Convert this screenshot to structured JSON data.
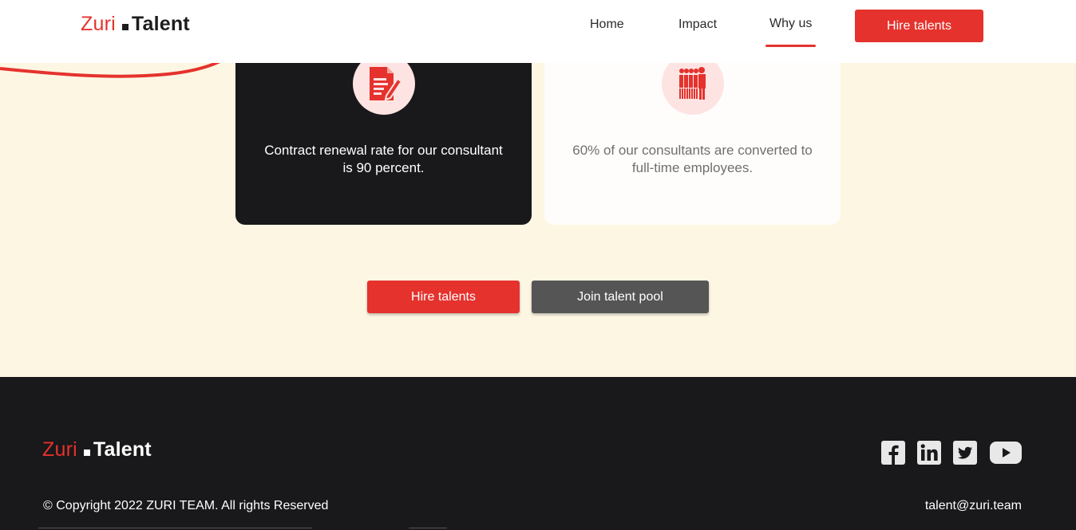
{
  "header": {
    "logo": {
      "zuri": "Zuri",
      "talent": "Talent"
    },
    "nav": [
      {
        "label": "Home"
      },
      {
        "label": "Impact"
      },
      {
        "label": "Why us",
        "active": true
      }
    ],
    "cta_label": "Hire talents"
  },
  "cards": [
    {
      "icon": "document-edit-icon",
      "text": "Contract renewal rate for our consultant is 90 percent.",
      "theme": "dark"
    },
    {
      "icon": "people-group-icon",
      "text": "60% of our consultants are converted to full-time employees.",
      "theme": "light"
    }
  ],
  "actions": {
    "hire_label": "Hire talents",
    "join_label": "Join talent pool"
  },
  "footer": {
    "logo": {
      "zuri": "Zuri",
      "talent": "Talent"
    },
    "copyright": "© Copyright 2022 ZURI TEAM. All rights Reserved",
    "email": "talent@zuri.team",
    "social": [
      "facebook-icon",
      "linkedin-icon",
      "twitter-icon",
      "youtube-icon"
    ]
  },
  "colors": {
    "accent": "#e5322d",
    "dark": "#19181a",
    "cream": "#fdf6e3",
    "icon_bg": "#fde4e2",
    "secondary_button": "#555555"
  }
}
